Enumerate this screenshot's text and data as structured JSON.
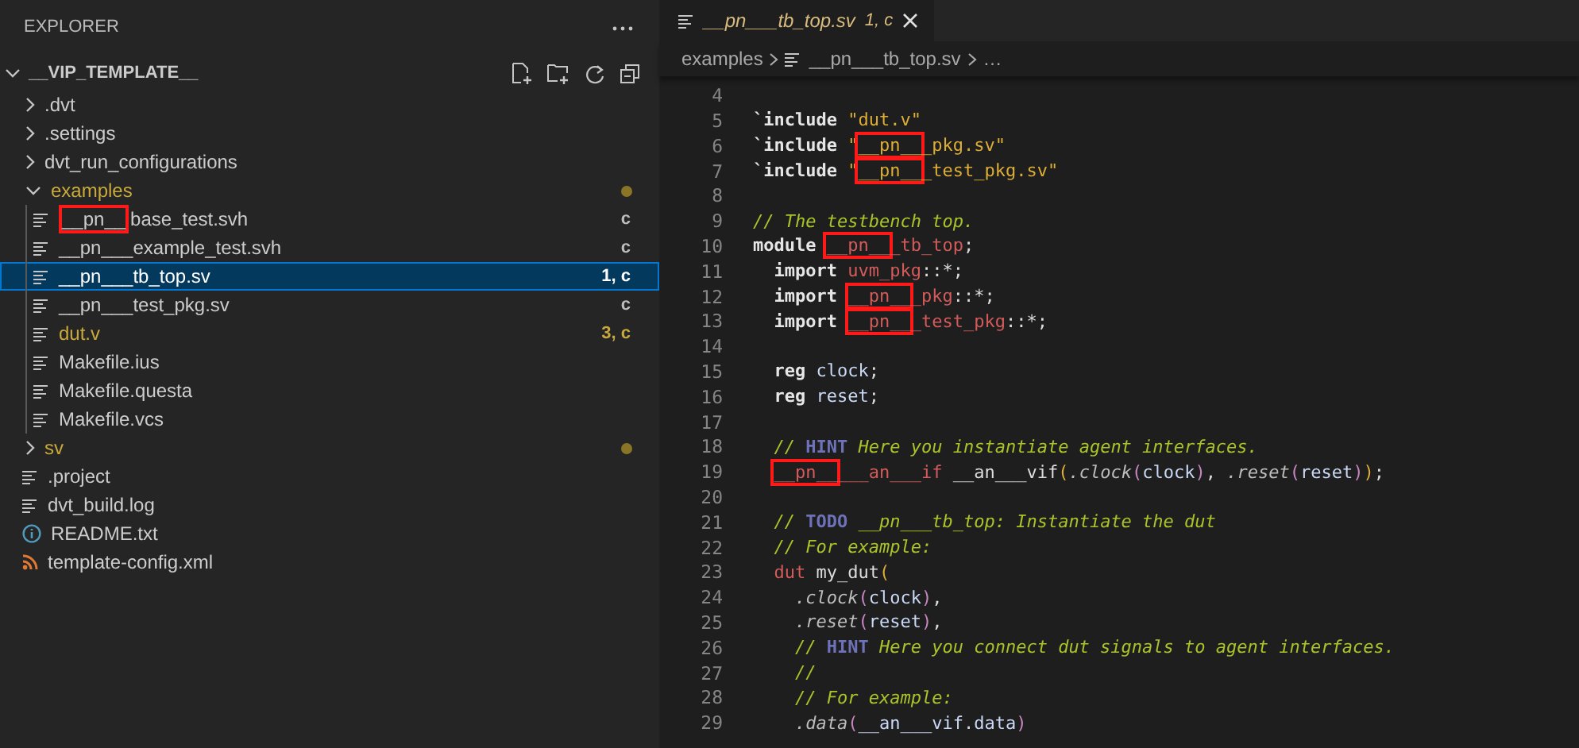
{
  "explorer": {
    "title": "EXPLORER",
    "root": {
      "label": "__VIP_TEMPLATE__",
      "expanded": true,
      "children": [
        {
          "label": ".dvt",
          "kind": "folder",
          "expanded": false,
          "selected": false
        },
        {
          "label": ".settings",
          "kind": "folder",
          "expanded": false,
          "selected": false
        },
        {
          "label": "dvt_run_configurations",
          "kind": "folder",
          "expanded": false,
          "selected": false
        },
        {
          "label": "examples",
          "kind": "folder",
          "expanded": true,
          "selected": false,
          "modified": true,
          "dot": true,
          "children": [
            {
              "label": "base_test.svh",
              "highlight_prefix": "__pn__",
              "kind": "file",
              "selected": false,
              "badge": "c"
            },
            {
              "label": "__pn___example_test.svh",
              "kind": "file",
              "selected": false,
              "badge": "c"
            },
            {
              "label": "__pn___tb_top.sv",
              "kind": "file",
              "selected": true,
              "badge": "1, c"
            },
            {
              "label": "__pn___test_pkg.sv",
              "kind": "file",
              "selected": false,
              "badge": "c"
            },
            {
              "label": "dut.v",
              "kind": "file",
              "selected": false,
              "modified": true,
              "badge": "3, c"
            },
            {
              "label": "Makefile.ius",
              "kind": "file",
              "selected": false
            },
            {
              "label": "Makefile.questa",
              "kind": "file",
              "selected": false
            },
            {
              "label": "Makefile.vcs",
              "kind": "file",
              "selected": false
            }
          ]
        },
        {
          "label": "sv",
          "kind": "folder",
          "expanded": false,
          "selected": false,
          "modified": true,
          "dot": true
        },
        {
          "label": ".project",
          "kind": "file",
          "selected": false
        },
        {
          "label": "dvt_build.log",
          "kind": "file",
          "selected": false
        },
        {
          "label": "README.txt",
          "kind": "info",
          "selected": false
        },
        {
          "label": "template-config.xml",
          "kind": "feed",
          "selected": false
        }
      ]
    }
  },
  "tab": {
    "label": "__pn___tb_top.sv",
    "badge": "1, c"
  },
  "breadcrumb": [
    "examples",
    "__pn___tb_top.sv",
    "…"
  ],
  "code": [
    {
      "n": "4"
    },
    {
      "n": "5",
      "tokens": [
        {
          "text": "`include ",
          "kind": "keyword"
        },
        {
          "text": "\"dut.v\"",
          "kind": "string"
        }
      ]
    },
    {
      "n": "6",
      "tokens": [
        {
          "text": "`include ",
          "kind": "keyword"
        },
        {
          "text": "\"",
          "kind": "string"
        },
        {
          "text": "__pn__",
          "kind": "string",
          "highlight": true
        },
        {
          "text": "_pkg.sv\"",
          "kind": "string"
        }
      ]
    },
    {
      "n": "7",
      "tokens": [
        {
          "text": "`include ",
          "kind": "keyword"
        },
        {
          "text": "\"",
          "kind": "string"
        },
        {
          "text": "__pn__",
          "kind": "string",
          "highlight": true
        },
        {
          "text": "_test_pkg.sv\"",
          "kind": "string"
        }
      ]
    },
    {
      "n": "8"
    },
    {
      "n": "9",
      "tokens": [
        {
          "text": "// The testbench top.",
          "kind": "comment"
        }
      ]
    },
    {
      "n": "10",
      "tokens": [
        {
          "text": "module ",
          "kind": "keyword"
        },
        {
          "text": "__pn__",
          "kind": "identifier",
          "highlight": true
        },
        {
          "text": "_tb_top",
          "kind": "identifier"
        },
        {
          "text": ";",
          "kind": "plain"
        }
      ]
    },
    {
      "n": "11",
      "tokens": [
        {
          "text": "  import ",
          "kind": "keyword"
        },
        {
          "text": "uvm_pkg",
          "kind": "identifier"
        },
        {
          "text": "::*;",
          "kind": "plain"
        }
      ]
    },
    {
      "n": "12",
      "tokens": [
        {
          "text": "  import ",
          "kind": "keyword"
        },
        {
          "text": "__pn__",
          "kind": "identifier",
          "highlight": true
        },
        {
          "text": "_pkg",
          "kind": "identifier"
        },
        {
          "text": "::*;",
          "kind": "plain"
        }
      ]
    },
    {
      "n": "13",
      "tokens": [
        {
          "text": "  import ",
          "kind": "keyword"
        },
        {
          "text": "__pn__",
          "kind": "identifier",
          "highlight": true
        },
        {
          "text": "_test_pkg",
          "kind": "identifier"
        },
        {
          "text": "::*;",
          "kind": "plain"
        }
      ]
    },
    {
      "n": "14"
    },
    {
      "n": "15",
      "tokens": [
        {
          "text": "  reg ",
          "kind": "keyword"
        },
        {
          "text": "clock",
          "kind": "variable"
        },
        {
          "text": ";",
          "kind": "plain"
        }
      ]
    },
    {
      "n": "16",
      "tokens": [
        {
          "text": "  reg ",
          "kind": "keyword"
        },
        {
          "text": "reset",
          "kind": "variable"
        },
        {
          "text": ";",
          "kind": "plain"
        }
      ]
    },
    {
      "n": "17"
    },
    {
      "n": "18",
      "tokens": [
        {
          "text": "  // ",
          "kind": "comment"
        },
        {
          "text": "HINT",
          "kind": "tag"
        },
        {
          "text": " Here you instantiate agent interfaces.",
          "kind": "comment"
        }
      ]
    },
    {
      "n": "19",
      "tokens": [
        {
          "text": "  __pn__",
          "kind": "identifier",
          "highlight": true
        },
        {
          "text": "___an___if",
          "kind": "identifier"
        },
        {
          "text": " __an___vif",
          "kind": "plain"
        },
        {
          "text": "(",
          "kind": "paren"
        },
        {
          "text": ".clock",
          "kind": "port"
        },
        {
          "text": "(",
          "kind": "inner-paren"
        },
        {
          "text": "clock",
          "kind": "variable"
        },
        {
          "text": ")",
          "kind": "inner-paren"
        },
        {
          "text": ", ",
          "kind": "plain"
        },
        {
          "text": ".reset",
          "kind": "port"
        },
        {
          "text": "(",
          "kind": "inner-paren"
        },
        {
          "text": "reset",
          "kind": "variable"
        },
        {
          "text": ")",
          "kind": "inner-paren"
        },
        {
          "text": ")",
          "kind": "paren"
        },
        {
          "text": ";",
          "kind": "plain"
        }
      ]
    },
    {
      "n": "20"
    },
    {
      "n": "21",
      "tokens": [
        {
          "text": "  // ",
          "kind": "comment"
        },
        {
          "text": "TODO",
          "kind": "tag"
        },
        {
          "text": " __pn___tb_top: Instantiate the dut",
          "kind": "comment"
        }
      ]
    },
    {
      "n": "22",
      "tokens": [
        {
          "text": "  // For example:",
          "kind": "comment"
        }
      ]
    },
    {
      "n": "23",
      "tokens": [
        {
          "text": "  dut",
          "kind": "identifier"
        },
        {
          "text": " my_dut",
          "kind": "plain"
        },
        {
          "text": "(",
          "kind": "paren"
        }
      ]
    },
    {
      "n": "24",
      "tokens": [
        {
          "text": "    .clock",
          "kind": "port"
        },
        {
          "text": "(",
          "kind": "inner-paren"
        },
        {
          "text": "clock",
          "kind": "variable"
        },
        {
          "text": ")",
          "kind": "inner-paren"
        },
        {
          "text": ",",
          "kind": "plain"
        }
      ]
    },
    {
      "n": "25",
      "tokens": [
        {
          "text": "    .reset",
          "kind": "port"
        },
        {
          "text": "(",
          "kind": "inner-paren"
        },
        {
          "text": "reset",
          "kind": "variable"
        },
        {
          "text": ")",
          "kind": "inner-paren"
        },
        {
          "text": ",",
          "kind": "plain"
        }
      ]
    },
    {
      "n": "26",
      "tokens": [
        {
          "text": "    // ",
          "kind": "comment"
        },
        {
          "text": "HINT",
          "kind": "tag"
        },
        {
          "text": " Here you connect dut signals to agent interfaces.",
          "kind": "comment"
        }
      ]
    },
    {
      "n": "27",
      "tokens": [
        {
          "text": "    //",
          "kind": "comment"
        }
      ]
    },
    {
      "n": "28",
      "tokens": [
        {
          "text": "    // For example:",
          "kind": "comment"
        }
      ]
    },
    {
      "n": "29",
      "tokens": [
        {
          "text": "    .data",
          "kind": "port"
        },
        {
          "text": "(",
          "kind": "inner-paren"
        },
        {
          "text": "__an___vif.data",
          "kind": "variable"
        },
        {
          "text": ")",
          "kind": "inner-paren"
        }
      ]
    }
  ]
}
